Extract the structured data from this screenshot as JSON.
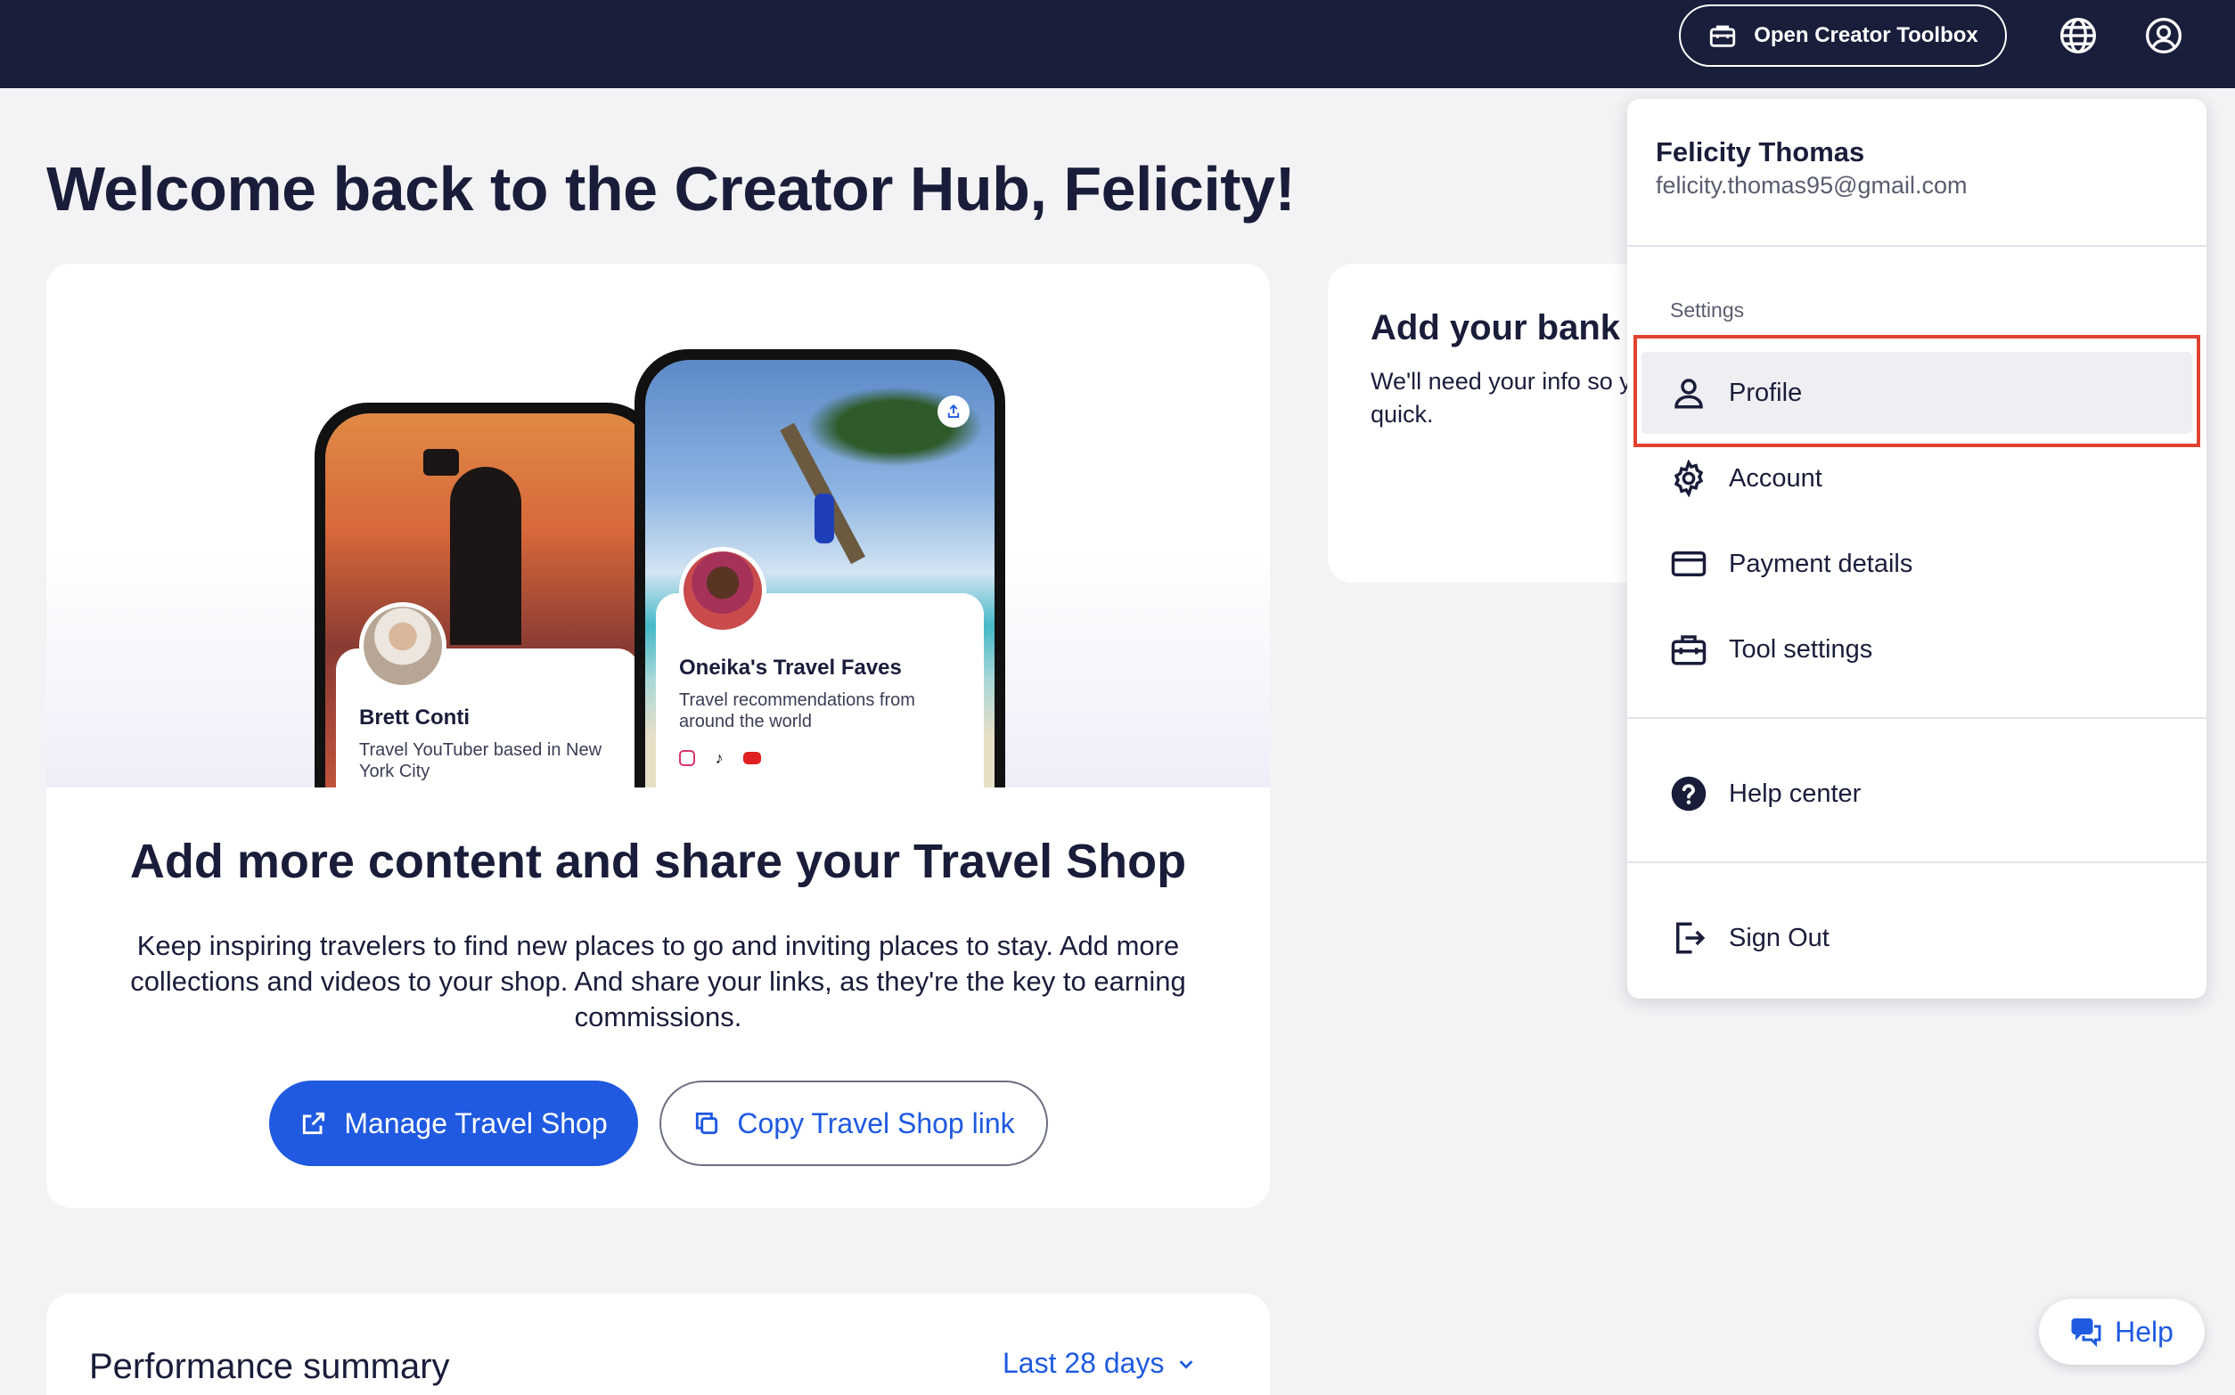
{
  "topbar": {
    "toolbox_label": "Open Creator Toolbox",
    "icons": [
      "briefcase-icon",
      "globe-icon",
      "user-circle-icon"
    ]
  },
  "page": {
    "title": "Welcome back to the Creator Hub, Felicity!"
  },
  "hero": {
    "profiles": [
      {
        "name": "Brett Conti",
        "desc": "Travel YouTuber based in New York City"
      },
      {
        "name": "Oneika's Travel Faves",
        "desc": "Travel recommendations from around the world",
        "social_icons": [
          "instagram-icon",
          "tiktok-icon",
          "youtube-icon"
        ]
      }
    ]
  },
  "main_card": {
    "title": "Add more content and share your Travel Shop",
    "text": "Keep inspiring travelers to find new places to go and inviting places to stay. Add more collections and videos to your shop. And share your links, as they're the key to earning commissions.",
    "primary_label": "Manage Travel Shop",
    "secondary_label": "Copy Travel Shop link"
  },
  "bank_card": {
    "title": "Add your bank details",
    "text": "We'll need your info so you can start earning. This part is quick."
  },
  "performance": {
    "title": "Performance summary",
    "range_label": "Last 28 days"
  },
  "menu": {
    "name": "Felicity Thomas",
    "email": "felicity.thomas95@gmail.com",
    "section_label": "Settings",
    "items": [
      {
        "label": "Profile",
        "icon": "person-icon"
      },
      {
        "label": "Account",
        "icon": "gear-icon"
      },
      {
        "label": "Payment details",
        "icon": "credit-card-icon"
      },
      {
        "label": "Tool settings",
        "icon": "toolbox-icon"
      }
    ],
    "help_label": "Help center",
    "signout_label": "Sign Out"
  },
  "help_pill": {
    "label": "Help"
  },
  "colors": {
    "topbar": "#191e3b",
    "accent": "#1f5ae0",
    "highlight": "#e0422f",
    "background": "#f3f3f5"
  }
}
